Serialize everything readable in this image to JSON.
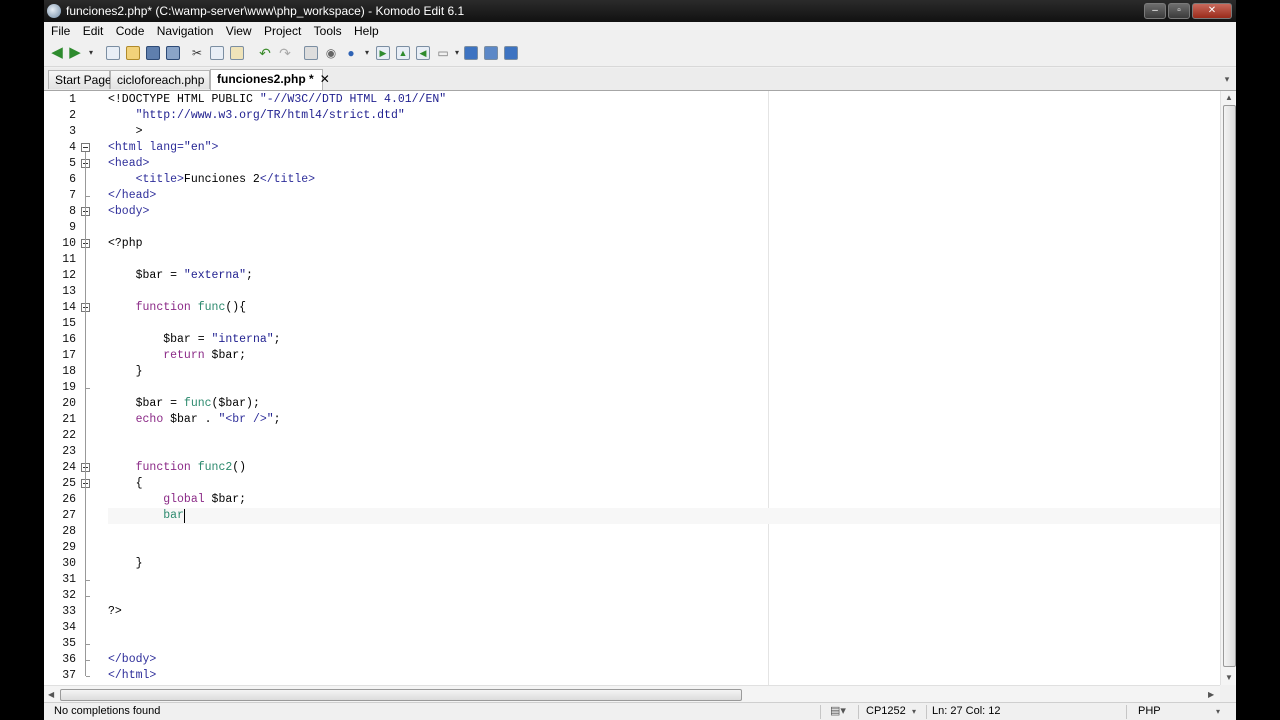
{
  "window": {
    "title": "funciones2.php* (C:\\wamp-server\\www\\php_workspace) - Komodo Edit 6.1",
    "buttons": [
      "minimize",
      "maximize",
      "close"
    ]
  },
  "menu": [
    "File",
    "Edit",
    "Code",
    "Navigation",
    "View",
    "Project",
    "Tools",
    "Help"
  ],
  "toolbar_icons": [
    "back-icon",
    "forward-icon",
    "dropdown-icon",
    "new-file-icon",
    "open-file-icon",
    "save-icon",
    "save-all-icon",
    "cut-icon",
    "copy-icon",
    "paste-icon",
    "undo-icon",
    "redo-icon",
    "print-icon",
    "preview-icon",
    "browser-icon",
    "dropdown-icon",
    "run-icon",
    "macro-icon",
    "toolbox-icon",
    "layout-icon",
    "dropdown-icon",
    "left-pane-icon",
    "bottom-pane-icon",
    "right-pane-icon"
  ],
  "tabs": [
    {
      "label": "Start Page",
      "active": false
    },
    {
      "label": "cicloforeach.php",
      "active": false
    },
    {
      "label": "funciones2.php *",
      "active": true
    }
  ],
  "editor": {
    "current_line": 27,
    "lines": [
      {
        "n": "1",
        "text": "<!DOCTYPE HTML PUBLIC \"-//W3C//DTD HTML 4.01//EN\""
      },
      {
        "n": "2",
        "text": "    \"http://www.w3.org/TR/html4/strict.dtd\""
      },
      {
        "n": "3",
        "text": "    >"
      },
      {
        "n": "4",
        "text": "<html lang=\"en\">",
        "fold": "start"
      },
      {
        "n": "5",
        "text": "<head>",
        "fold": "start"
      },
      {
        "n": "6",
        "text": "    <title>Funciones 2</title>"
      },
      {
        "n": "7",
        "text": "</head>",
        "fold": "end"
      },
      {
        "n": "8",
        "text": "<body>",
        "fold": "start"
      },
      {
        "n": "9",
        "text": ""
      },
      {
        "n": "10",
        "text": "<?php",
        "fold": "start"
      },
      {
        "n": "11",
        "text": ""
      },
      {
        "n": "12",
        "text": "    $bar = \"externa\";"
      },
      {
        "n": "13",
        "text": ""
      },
      {
        "n": "14",
        "text": "    function func(){",
        "fold": "start"
      },
      {
        "n": "15",
        "text": ""
      },
      {
        "n": "16",
        "text": "        $bar = \"interna\";"
      },
      {
        "n": "17",
        "text": "        return $bar;"
      },
      {
        "n": "18",
        "text": "    }"
      },
      {
        "n": "19",
        "text": "",
        "fold": "end"
      },
      {
        "n": "20",
        "text": "    $bar = func($bar);"
      },
      {
        "n": "21",
        "text": "    echo $bar . \"<br />\";"
      },
      {
        "n": "22",
        "text": ""
      },
      {
        "n": "23",
        "text": ""
      },
      {
        "n": "24",
        "text": "    function func2()",
        "fold": "start"
      },
      {
        "n": "25",
        "text": "    {",
        "fold": "start"
      },
      {
        "n": "26",
        "text": "        global $bar;"
      },
      {
        "n": "27",
        "text": "        bar"
      },
      {
        "n": "28",
        "text": ""
      },
      {
        "n": "29",
        "text": ""
      },
      {
        "n": "30",
        "text": "    }"
      },
      {
        "n": "31",
        "text": "",
        "fold": "end"
      },
      {
        "n": "32",
        "text": "",
        "fold": "end"
      },
      {
        "n": "33",
        "text": "?>"
      },
      {
        "n": "34",
        "text": ""
      },
      {
        "n": "35",
        "text": "",
        "fold": "end"
      },
      {
        "n": "36",
        "text": "</body>",
        "fold": "end"
      },
      {
        "n": "37",
        "text": "</html>",
        "fold": "end"
      }
    ]
  },
  "status": {
    "message": "No completions found",
    "encoding": "CP1252",
    "position": "Ln: 27 Col: 12",
    "language": "PHP"
  }
}
